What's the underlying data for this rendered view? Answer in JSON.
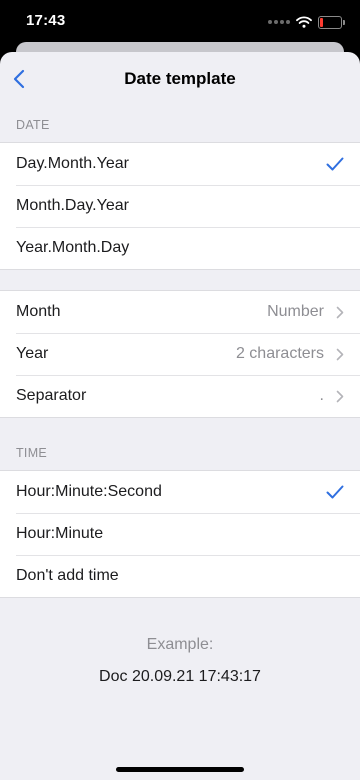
{
  "status_bar": {
    "time": "17:43"
  },
  "nav": {
    "title": "Date template"
  },
  "date_section": {
    "header": "DATE",
    "options": [
      {
        "label": "Day.Month.Year",
        "selected": true
      },
      {
        "label": "Month.Day.Year",
        "selected": false
      },
      {
        "label": "Year.Month.Day",
        "selected": false
      }
    ]
  },
  "settings": [
    {
      "label": "Month",
      "value": "Number"
    },
    {
      "label": "Year",
      "value": "2 characters"
    },
    {
      "label": "Separator",
      "value": "."
    }
  ],
  "time_section": {
    "header": "TIME",
    "options": [
      {
        "label": "Hour:Minute:Second",
        "selected": true
      },
      {
        "label": "Hour:Minute",
        "selected": false
      },
      {
        "label": "Don't add time",
        "selected": false
      }
    ]
  },
  "example": {
    "label": "Example:",
    "value": "Doc 20.09.21 17:43:17"
  },
  "colors": {
    "accent": "#2f6fe0",
    "background": "#efeff4",
    "battery_low": "#ff3b30"
  },
  "icons": [
    "wifi-icon",
    "battery-icon",
    "back-chevron-icon",
    "checkmark-icon",
    "chevron-right-icon"
  ]
}
